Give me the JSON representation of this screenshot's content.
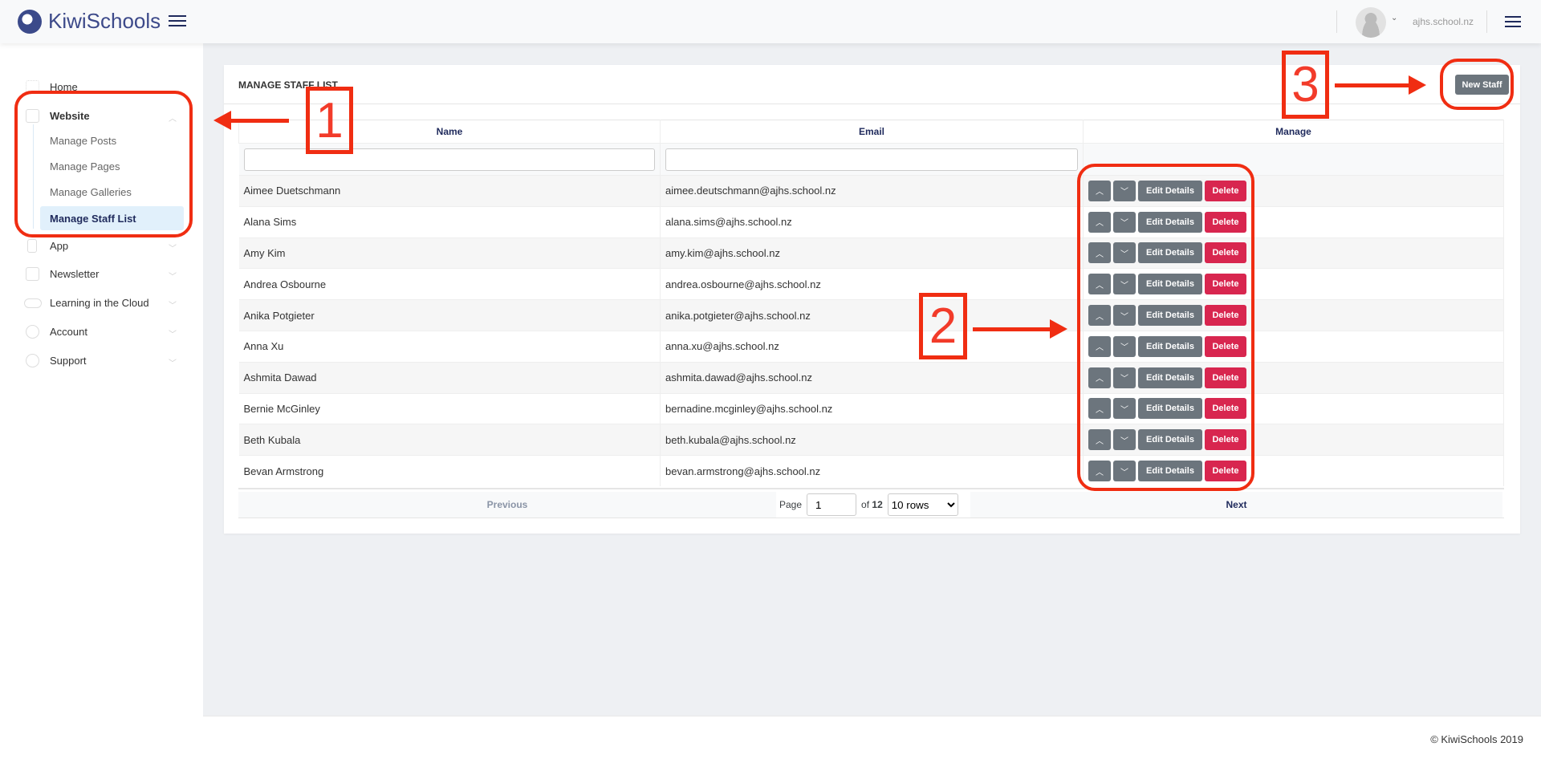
{
  "header": {
    "brand": "KiwiSchools",
    "domain": "ajhs.school.nz"
  },
  "sidebar": {
    "items": [
      {
        "label": "Home",
        "icon": "grid-icon"
      },
      {
        "label": "Website",
        "icon": "window-icon",
        "expanded": true,
        "children": [
          "Manage Posts",
          "Manage Pages",
          "Manage Galleries",
          "Manage Staff List"
        ],
        "active_child": "Manage Staff List"
      },
      {
        "label": "App",
        "icon": "phone-icon"
      },
      {
        "label": "Newsletter",
        "icon": "newspaper-icon"
      },
      {
        "label": "Learning in the Cloud",
        "icon": "cloud-icon"
      },
      {
        "label": "Account",
        "icon": "user-icon"
      },
      {
        "label": "Support",
        "icon": "help-icon"
      }
    ]
  },
  "card": {
    "title": "MANAGE STAFF LIST",
    "new_button": "New Staff"
  },
  "table": {
    "columns": [
      "Name",
      "Email",
      "Manage"
    ],
    "rows": [
      {
        "name": "Aimee Duetschmann",
        "email": "aimee.deutschmann@ajhs.school.nz"
      },
      {
        "name": "Alana Sims",
        "email": "alana.sims@ajhs.school.nz"
      },
      {
        "name": "Amy Kim",
        "email": "amy.kim@ajhs.school.nz"
      },
      {
        "name": "Andrea Osbourne",
        "email": "andrea.osbourne@ajhs.school.nz"
      },
      {
        "name": "Anika Potgieter",
        "email": "anika.potgieter@ajhs.school.nz"
      },
      {
        "name": "Anna Xu",
        "email": "anna.xu@ajhs.school.nz"
      },
      {
        "name": "Ashmita Dawad",
        "email": "ashmita.dawad@ajhs.school.nz"
      },
      {
        "name": "Bernie McGinley",
        "email": "bernadine.mcginley@ajhs.school.nz"
      },
      {
        "name": "Beth Kubala",
        "email": "beth.kubala@ajhs.school.nz"
      },
      {
        "name": "Bevan Armstrong",
        "email": "bevan.armstrong@ajhs.school.nz"
      }
    ],
    "actions": {
      "edit": "Edit Details",
      "delete": "Delete"
    }
  },
  "pagination": {
    "previous": "Previous",
    "next": "Next",
    "page_label": "Page",
    "page": "1",
    "of_label": "of",
    "total_pages": "12",
    "rows_option": "10 rows"
  },
  "footer": {
    "copyright": "© KiwiSchools 2019"
  },
  "annotations": {
    "n1": "1",
    "n2": "2",
    "n3": "3",
    "color": "#f02d12"
  }
}
